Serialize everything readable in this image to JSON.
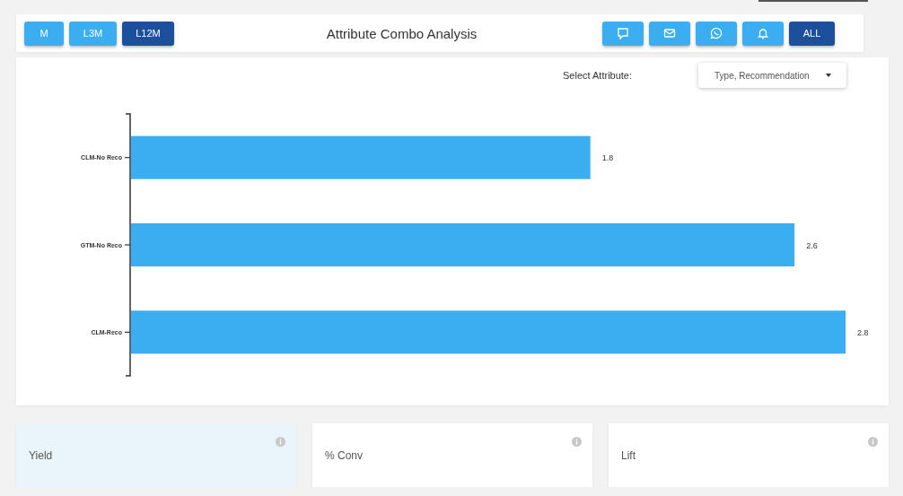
{
  "period_buttons": [
    {
      "label": "M",
      "selected": false
    },
    {
      "label": "L3M",
      "selected": false
    },
    {
      "label": "L12M",
      "selected": true
    }
  ],
  "title": "Attribute Combo Analysis",
  "channel_buttons": [
    {
      "kind": "chat",
      "selected": false
    },
    {
      "kind": "mail",
      "selected": false
    },
    {
      "kind": "whatsapp",
      "selected": false
    },
    {
      "kind": "bell",
      "selected": false
    },
    {
      "kind": "text",
      "label": "ALL",
      "selected": true
    }
  ],
  "attribute_select": {
    "label": "Select Attribute:",
    "value": "Type, Recommendation"
  },
  "chart_data": {
    "type": "bar",
    "orientation": "horizontal",
    "categories": [
      "CLM-No Reco",
      "GTM-No Reco",
      "CLM-Reco"
    ],
    "values": [
      1.8,
      2.6,
      2.8
    ],
    "data_labels": true
  },
  "metric_cards": [
    {
      "label": "Yield",
      "selected": true
    },
    {
      "label": "% Conv",
      "selected": false
    },
    {
      "label": "Lift",
      "selected": false
    }
  ]
}
